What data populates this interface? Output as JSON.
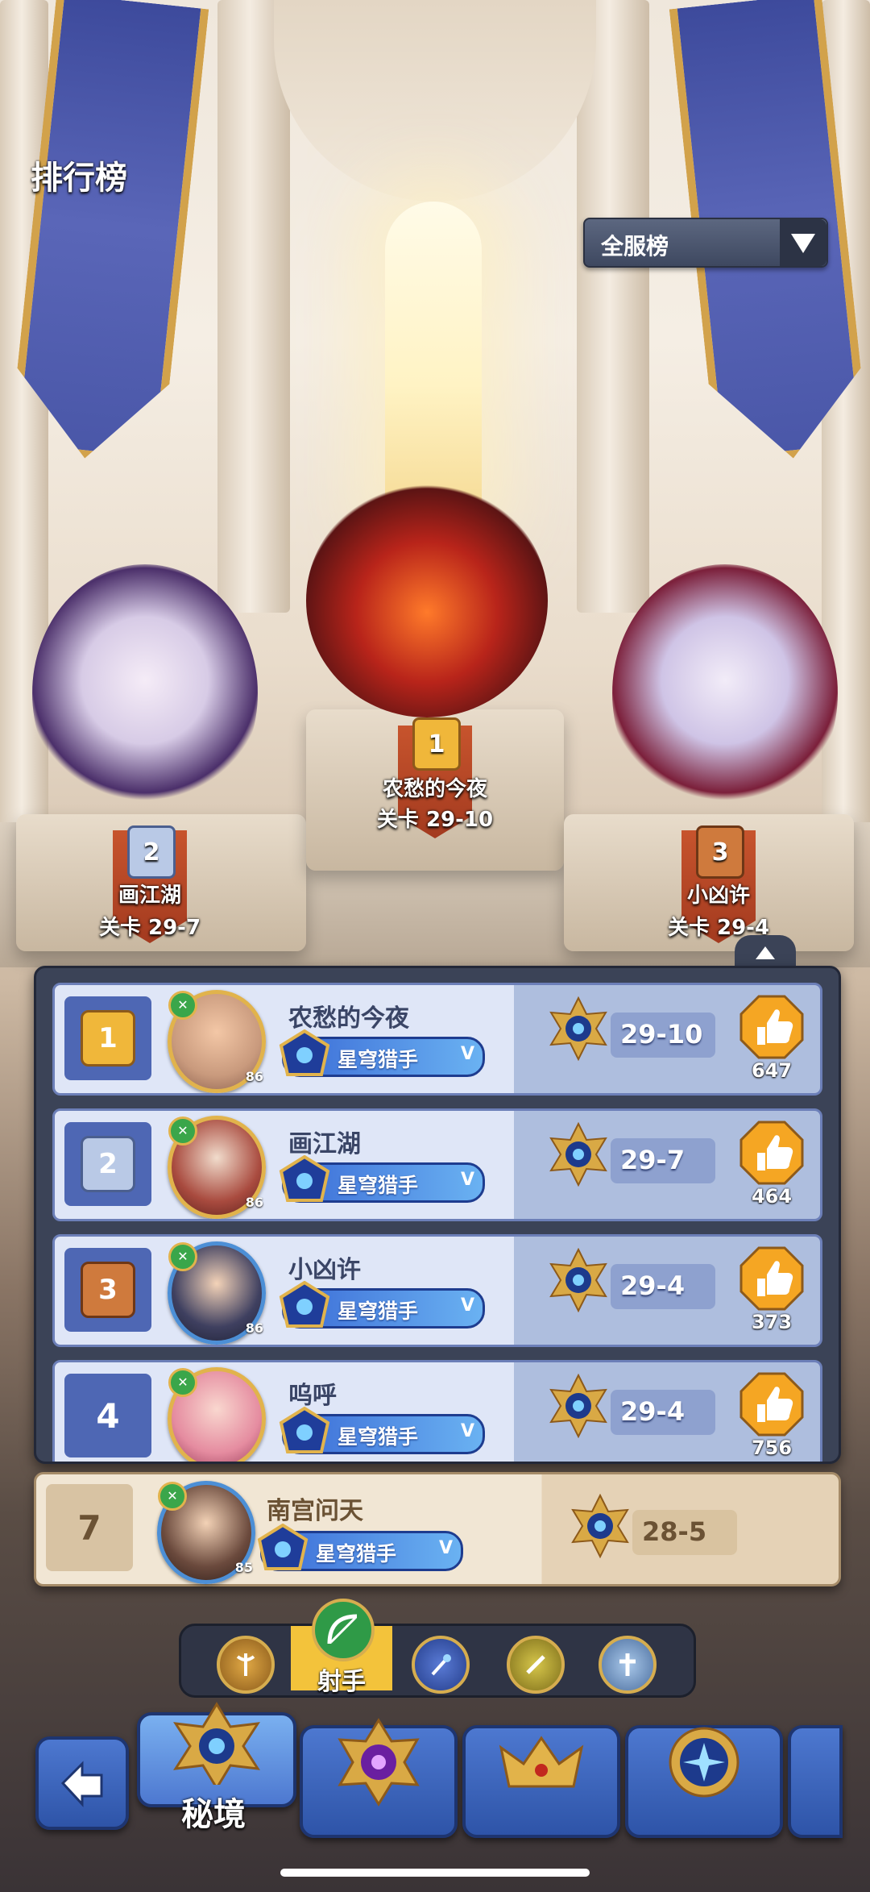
{
  "header": {
    "title": "排行榜",
    "dropdown_label": "全服榜"
  },
  "podium": [
    {
      "rank": "1",
      "name": "农愁的今夜",
      "stage": "关卡 29-10"
    },
    {
      "rank": "2",
      "name": "画江湖",
      "stage": "关卡 29-7"
    },
    {
      "rank": "3",
      "name": "小凶许",
      "stage": "关卡 29-4"
    }
  ],
  "list": [
    {
      "rank": "1",
      "name": "农愁的今夜",
      "level": "86",
      "title": "星穹猎手",
      "title_tag": "V",
      "stage": "29-10",
      "likes": "647"
    },
    {
      "rank": "2",
      "name": "画江湖",
      "level": "86",
      "title": "星穹猎手",
      "title_tag": "V",
      "stage": "29-7",
      "likes": "464"
    },
    {
      "rank": "3",
      "name": "小凶许",
      "level": "86",
      "title": "星穹猎手",
      "title_tag": "V",
      "stage": "29-4",
      "likes": "373"
    },
    {
      "rank": "4",
      "name": "呜呼",
      "level": "",
      "title": "星穹猎手",
      "title_tag": "V",
      "stage": "29-4",
      "likes": "756"
    }
  ],
  "my_entry": {
    "rank": "7",
    "name": "南宫问天",
    "level": "85",
    "title": "星穹猎手",
    "title_tag": "V",
    "stage": "28-5"
  },
  "class_tabs": {
    "active_label": "射手",
    "icons": [
      "axe-icon",
      "bow-icon",
      "staff-icon",
      "dagger-icon",
      "cross-icon"
    ]
  },
  "bottom_nav": {
    "active_label": "秘境",
    "items": [
      "back-icon",
      "secret-realm-icon",
      "purple-orb-icon",
      "crown-icon",
      "star-compass-icon"
    ]
  },
  "colors": {
    "rank_gold": "#f0b73a",
    "rank_silver": "#b9c9e6",
    "rank_bronze": "#cf7a3d",
    "row_blue": "#dfe6f7",
    "my_row": "#f1e6d4"
  }
}
